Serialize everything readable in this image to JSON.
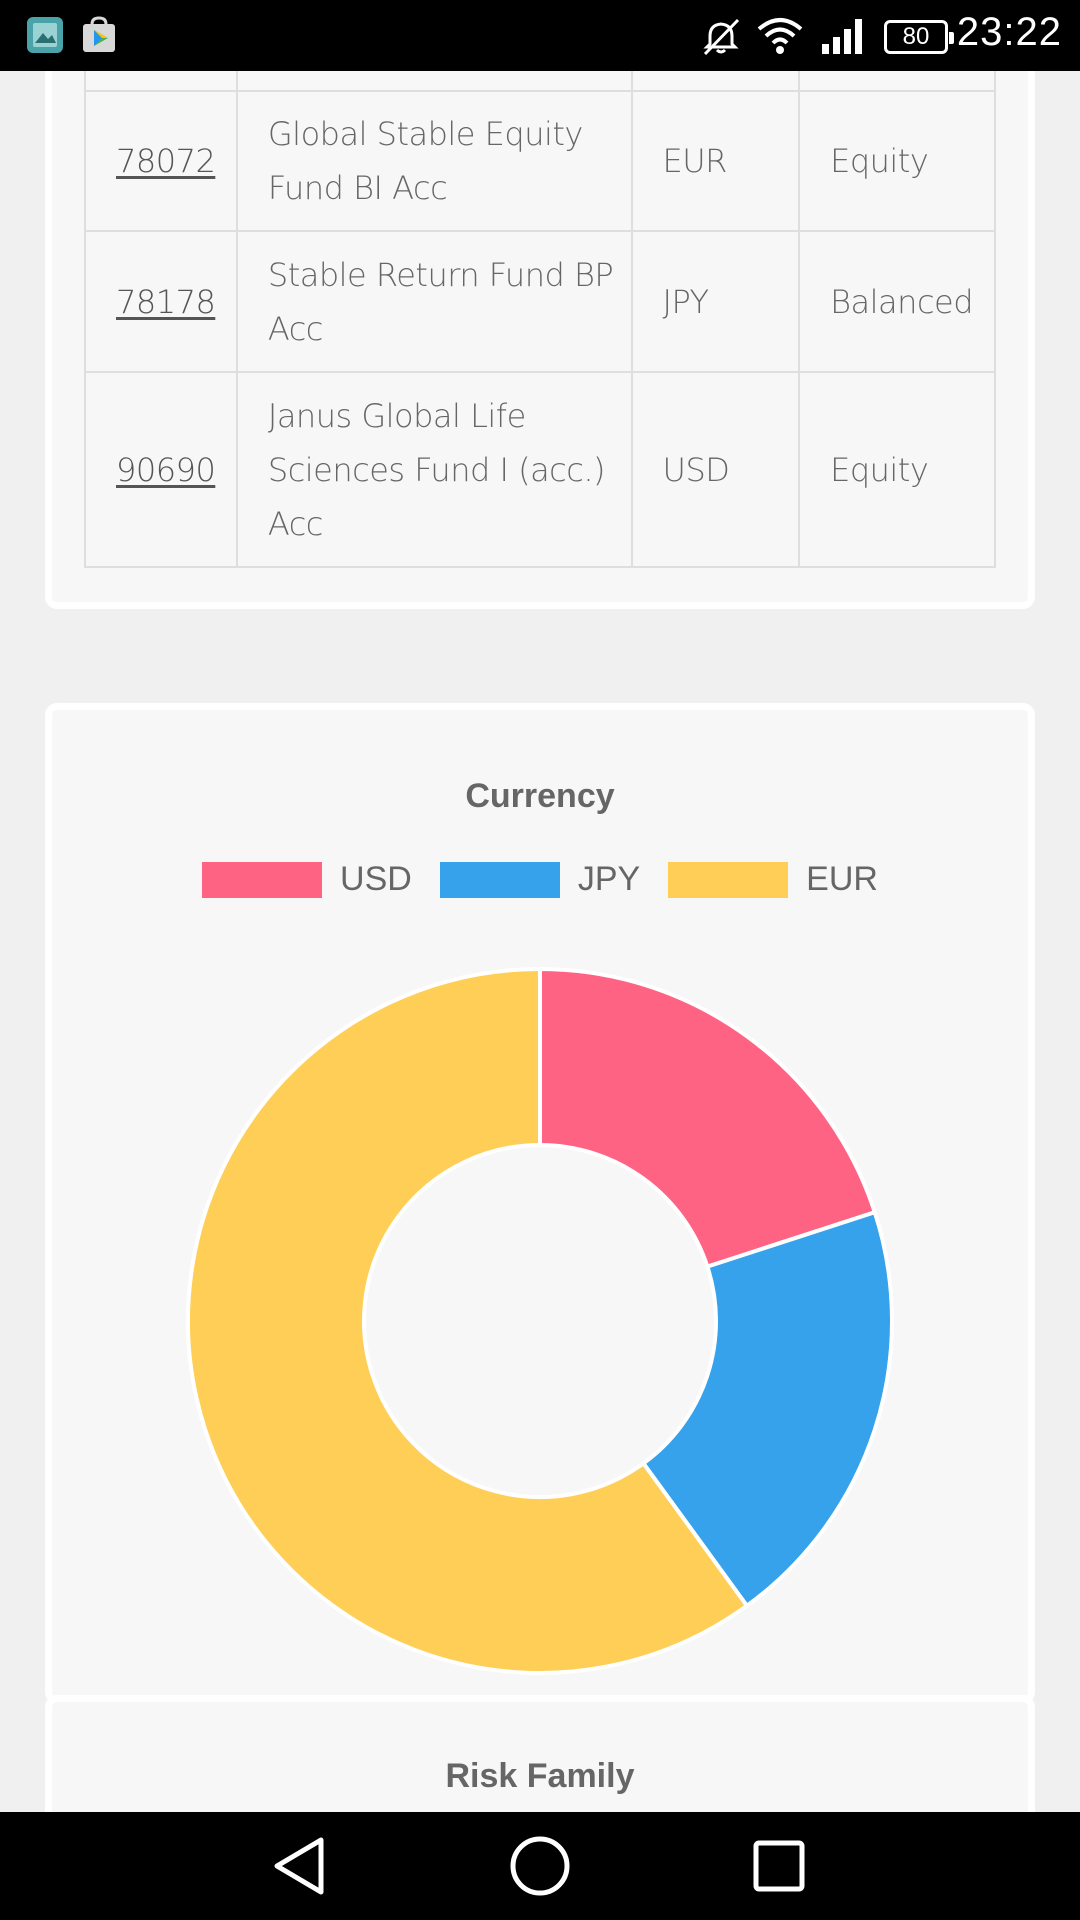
{
  "status_bar": {
    "time": "23:22",
    "battery": "80",
    "icons": [
      "gallery-app-icon",
      "play-store-icon",
      "mute-icon",
      "wifi-icon",
      "signal-icon",
      "battery-icon"
    ]
  },
  "fund_table": {
    "rows": [
      {
        "id": "",
        "name": "",
        "currency": "",
        "type": ""
      },
      {
        "id": "78072",
        "name": "Global Stable Equity Fund BI Acc",
        "currency": "EUR",
        "type": "Equity"
      },
      {
        "id": "78178",
        "name": "Stable Return Fund BP Acc",
        "currency": "JPY",
        "type": "Balanced"
      },
      {
        "id": "90690",
        "name": "Janus Global Life Sciences Fund I (acc.) Acc",
        "currency": "USD",
        "type": "Equity"
      }
    ]
  },
  "currency_chart": {
    "title": "Currency"
  },
  "chart_data": {
    "type": "pie",
    "title": "Currency",
    "categories": [
      "USD",
      "JPY",
      "EUR"
    ],
    "values": [
      1,
      1,
      3
    ],
    "colors": [
      "#ff6384",
      "#36a2eb",
      "#ffce56"
    ],
    "legend": "top",
    "donut": true
  },
  "risk_chart": {
    "title": "Risk Family"
  },
  "nav": {
    "icons": [
      "back-icon",
      "home-icon",
      "recents-icon"
    ]
  }
}
